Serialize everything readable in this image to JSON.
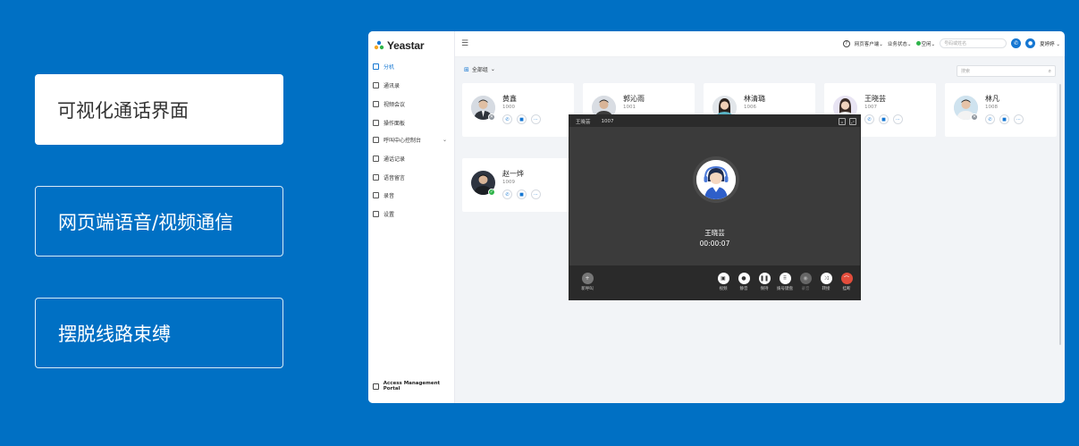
{
  "features": [
    {
      "label": "可视化通话界面"
    },
    {
      "label": "网页端语音/视频通信"
    },
    {
      "label": "摆脱线路束缚"
    }
  ],
  "app": {
    "logo": "Yeastar",
    "sidebar": [
      {
        "label": "分机",
        "icon": "extension-icon"
      },
      {
        "label": "通讯录",
        "icon": "contacts-icon"
      },
      {
        "label": "视频会议",
        "icon": "video-conference-icon"
      },
      {
        "label": "操作面板",
        "icon": "panel-icon"
      },
      {
        "label": "呼叫中心控制台",
        "icon": "headset-icon"
      },
      {
        "label": "通话记录",
        "icon": "call-log-icon"
      },
      {
        "label": "语音留言",
        "icon": "voicemail-icon"
      },
      {
        "label": "录音",
        "icon": "mic-icon"
      },
      {
        "label": "设置",
        "icon": "settings-icon"
      }
    ],
    "portal": "Access Management Portal",
    "topbar": {
      "web_client": "网页客户端",
      "work_status": "业务状态",
      "presence": "空闲",
      "search_placeholder": "号码或姓名",
      "user": "夏婷婷"
    },
    "group": "全部组",
    "search_placeholder": "搜索",
    "contacts": [
      {
        "name": "黄鑫",
        "ext": "1000",
        "status": "gray"
      },
      {
        "name": "郭沁雨",
        "ext": "1001",
        "status": "none"
      },
      {
        "name": "林清璐",
        "ext": "1006",
        "status": "none"
      },
      {
        "name": "王晓芸",
        "ext": "1007",
        "status": "none"
      },
      {
        "name": "林凡",
        "ext": "1008",
        "status": "gray"
      },
      {
        "name": "赵一烨",
        "ext": "1009",
        "status": "green"
      }
    ],
    "call": {
      "header_name": "王晓芸",
      "header_ext": "1007",
      "name": "王晓芸",
      "duration": "00:00:07",
      "controls": {
        "add": "新呼叫",
        "video": "视频",
        "mute": "静音",
        "hold": "保持",
        "keypad": "拨号键盘",
        "record": "录音",
        "transfer": "转接",
        "hangup": "挂断"
      }
    }
  }
}
